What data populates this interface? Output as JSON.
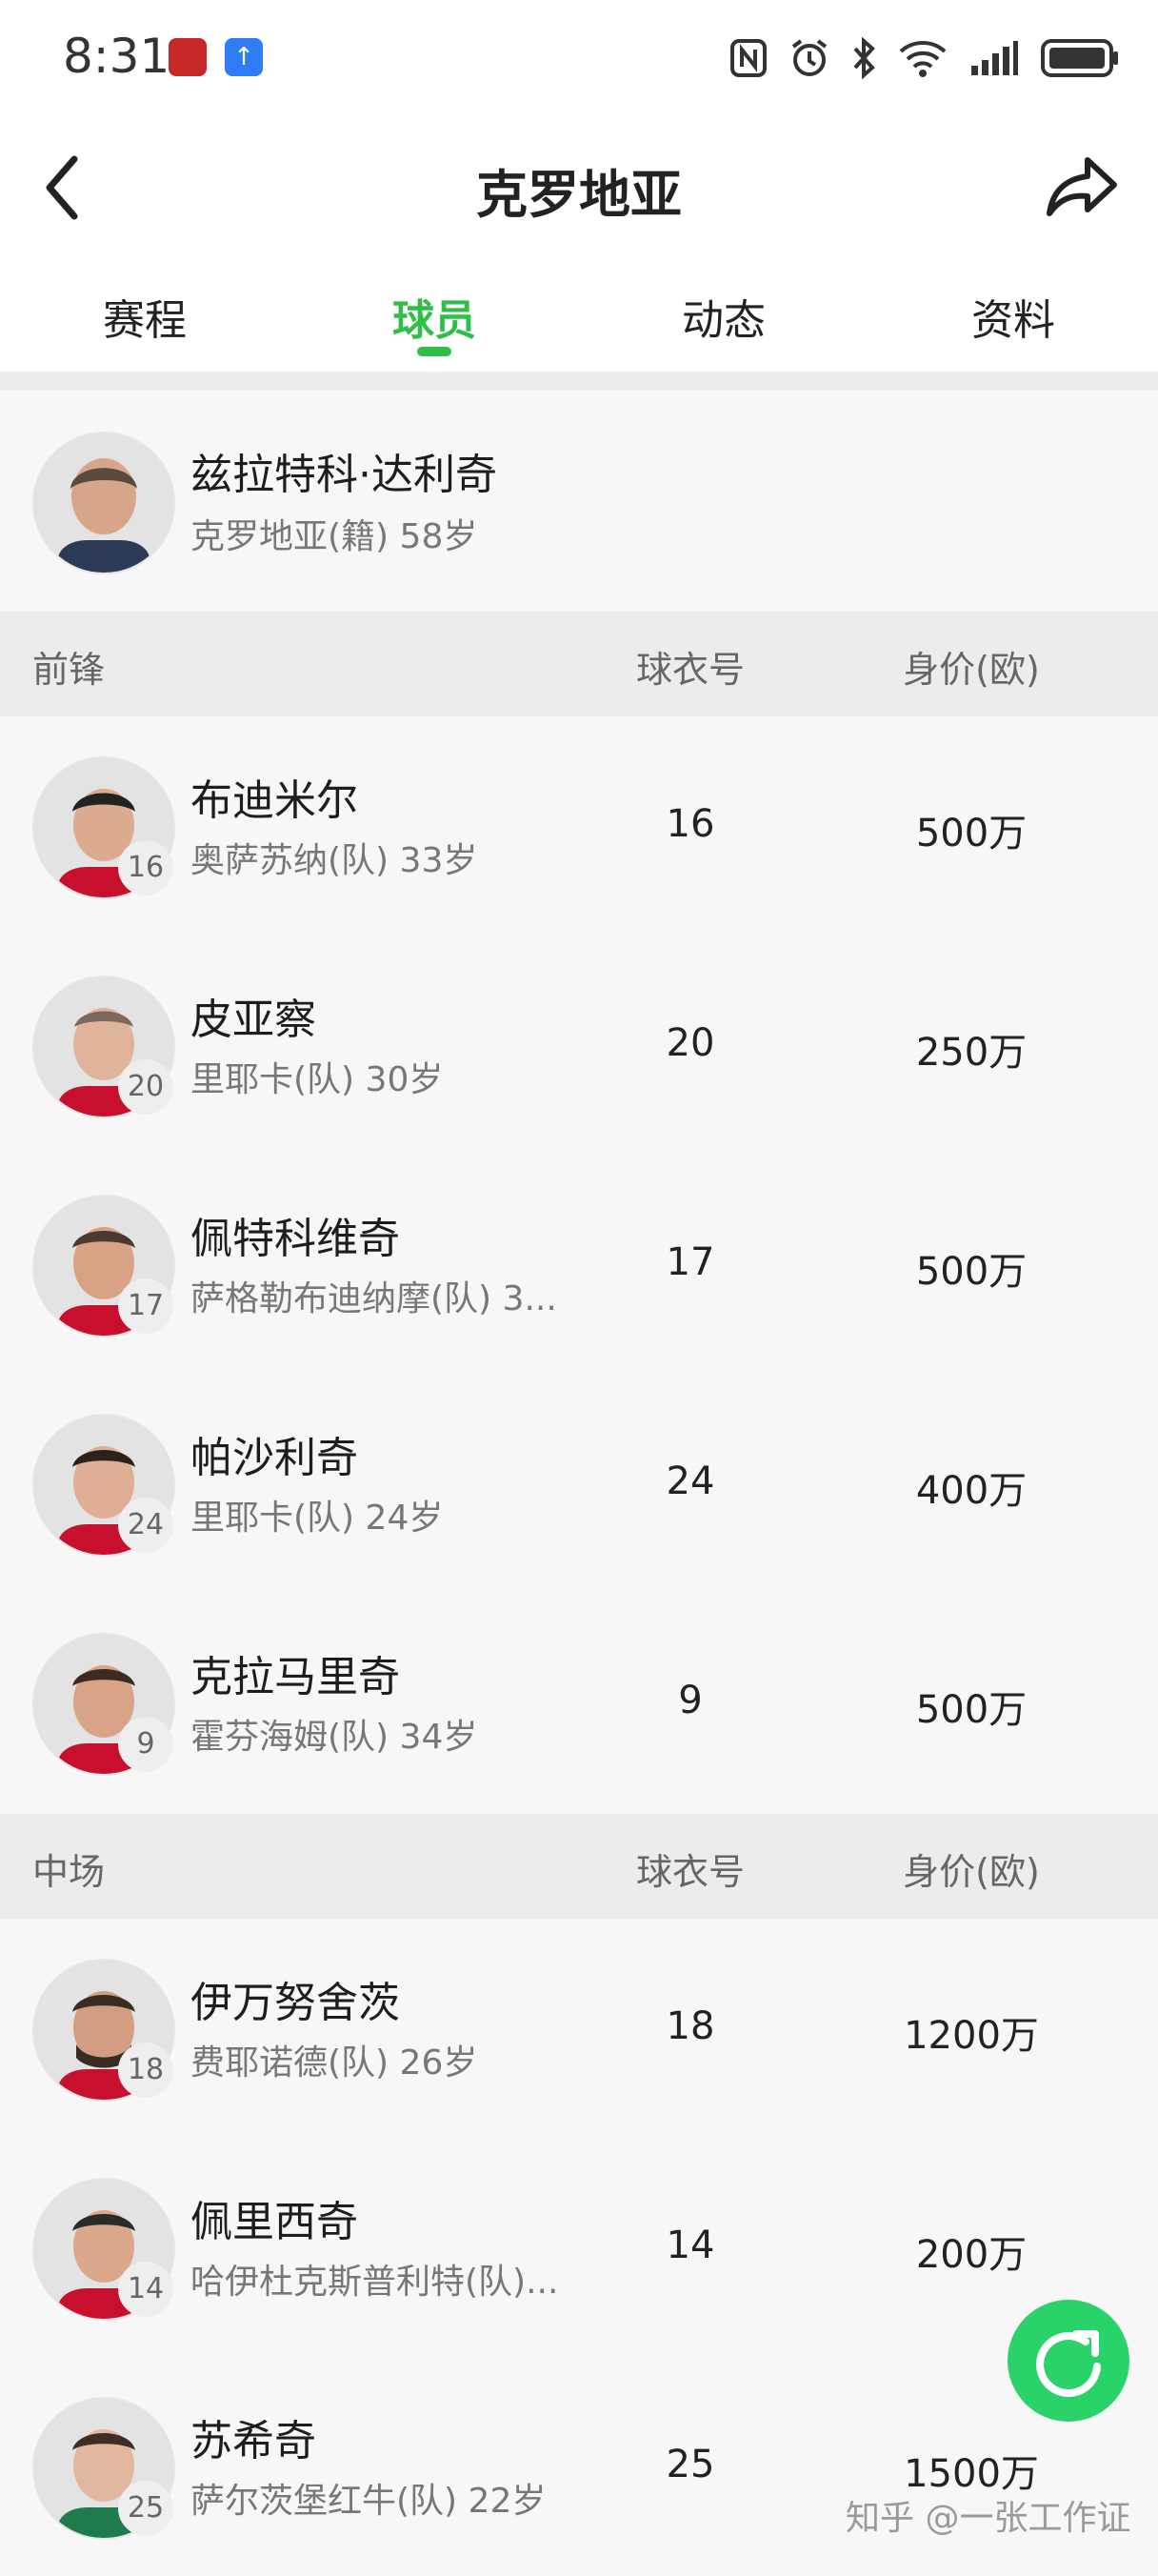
{
  "status_bar": {
    "time": "8:31"
  },
  "header": {
    "title": "克罗地亚"
  },
  "tabs": [
    {
      "label": "赛程",
      "active": false
    },
    {
      "label": "球员",
      "active": true
    },
    {
      "label": "动态",
      "active": false
    },
    {
      "label": "资料",
      "active": false
    }
  ],
  "coach": {
    "name": "兹拉特科·达利奇",
    "info": "克罗地亚(籍) 58岁"
  },
  "sections": [
    {
      "name": "前锋",
      "col_number": "球衣号",
      "col_value": "身价(欧)",
      "players": [
        {
          "name": "布迪米尔",
          "info": "奥萨苏纳(队) 33岁",
          "number": "16",
          "value": "500万"
        },
        {
          "name": "皮亚察",
          "info": "里耶卡(队) 30岁",
          "number": "20",
          "value": "250万"
        },
        {
          "name": "佩特科维奇",
          "info": "萨格勒布迪纳摩(队) 3...",
          "number": "17",
          "value": "500万"
        },
        {
          "name": "帕沙利奇",
          "info": "里耶卡(队) 24岁",
          "number": "24",
          "value": "400万"
        },
        {
          "name": "克拉马里奇",
          "info": "霍芬海姆(队) 34岁",
          "number": "9",
          "value": "500万"
        }
      ]
    },
    {
      "name": "中场",
      "col_number": "球衣号",
      "col_value": "身价(欧)",
      "players": [
        {
          "name": "伊万努舍茨",
          "info": "费耶诺德(队) 26岁",
          "number": "18",
          "value": "1200万"
        },
        {
          "name": "佩里西奇",
          "info": "哈伊杜克斯普利特(队)...",
          "number": "14",
          "value": "200万"
        },
        {
          "name": "苏希奇",
          "info": "萨尔茨堡红牛(队) 22岁",
          "number": "25",
          "value": "1500万"
        }
      ]
    }
  ],
  "watermark": "知乎 @一张工作证",
  "colors": {
    "accent": "#2fbf47",
    "fab": "#2ad36a"
  },
  "icons": [
    "back-arrow-icon",
    "share-icon",
    "refresh-icon",
    "nfc-icon",
    "alarm-icon",
    "bluetooth-icon",
    "wifi-icon",
    "signal-icon",
    "battery-icon"
  ]
}
